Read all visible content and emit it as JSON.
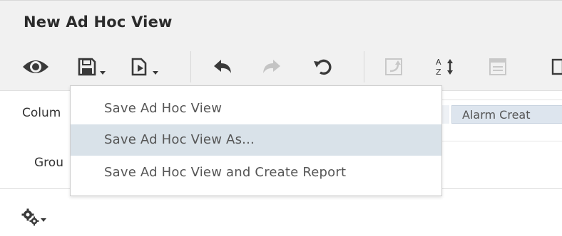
{
  "window": {
    "title": "New Ad Hoc View"
  },
  "toolbar": {
    "icons": [
      "eye-icon",
      "save-icon",
      "export-icon",
      "undo-icon",
      "redo-icon",
      "reset-icon",
      "pivot-icon",
      "sort-icon",
      "options-icon"
    ]
  },
  "columns": {
    "label": "Colum",
    "chip": "Alarm Creat"
  },
  "groups": {
    "label": "Grou"
  },
  "menu": {
    "items": [
      {
        "label": "Save Ad Hoc View",
        "highlighted": false
      },
      {
        "label": "Save Ad Hoc View As...",
        "highlighted": true
      },
      {
        "label": "Save Ad Hoc View and Create Report",
        "highlighted": false
      }
    ]
  },
  "colors": {
    "menu_highlight": "#d9e2e9",
    "toolbar_bg": "#f1f1f1",
    "chip_bg": "#dde5ee"
  }
}
